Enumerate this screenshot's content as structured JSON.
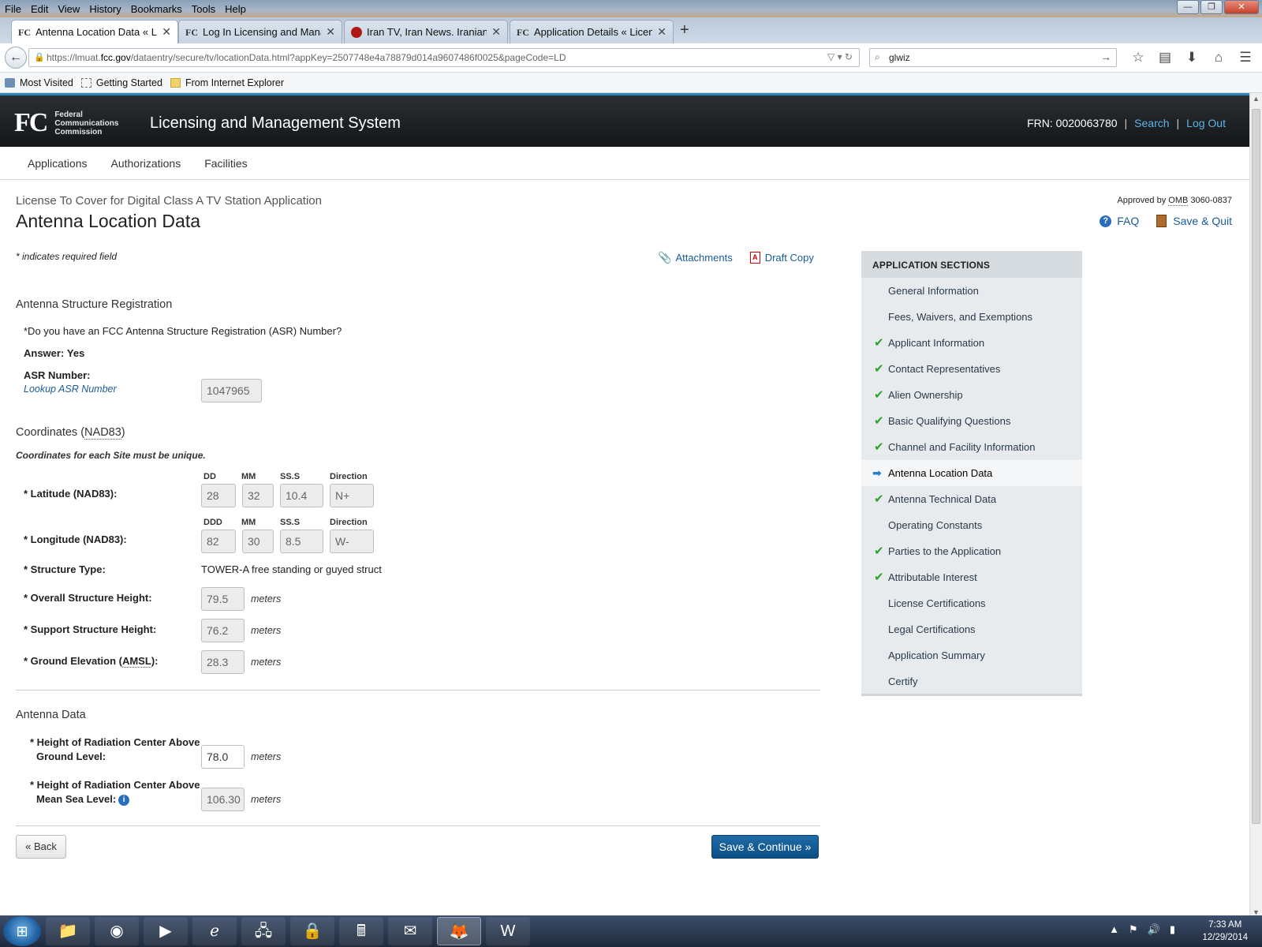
{
  "browser": {
    "menu": [
      "File",
      "Edit",
      "View",
      "History",
      "Bookmarks",
      "Tools",
      "Help"
    ],
    "tabs": [
      {
        "favicon": "FC",
        "label": "Antenna Location Data « Li...",
        "active": true
      },
      {
        "favicon": "FC",
        "label": "Log In Licensing and Mana..."
      },
      {
        "favicon": "iran-tv-favicon",
        "label": "Iran TV, Iran News. Iranian ..."
      },
      {
        "favicon": "FC",
        "label": "Application Details « Licen..."
      }
    ],
    "url_prefix": "https://lmuat.",
    "url_domain": "fcc.gov",
    "url_rest": "/dataentry/secure/tv/locationData.html?appKey=2507748e4a78879d014a9607486f0025&pageCode=LD",
    "search_value": "glwiz",
    "bookmarks": [
      "Most Visited",
      "Getting Started",
      "From Internet Explorer"
    ]
  },
  "header": {
    "logo_text": "FC",
    "agency_line1": "Federal",
    "agency_line2": "Communications",
    "agency_line3": "Commission",
    "title": "Licensing and Management System",
    "frn": "FRN: 0020063780",
    "search": "Search",
    "logout": "Log Out"
  },
  "subnav": [
    "Applications",
    "Authorizations",
    "Facilities"
  ],
  "page": {
    "subtitle": "License To Cover for Digital Class A TV Station Application",
    "title": "Antenna Location Data",
    "omb_prefix": "Approved by",
    "omb_abbr": "OMB",
    "omb_number": "3060-0837",
    "faq": "FAQ",
    "save_quit": "Save & Quit",
    "required_note": "* indicates required field",
    "attachments": "Attachments",
    "draft_copy": "Draft Copy"
  },
  "asr": {
    "section": "Antenna Structure Registration",
    "question": "*Do you have an FCC Antenna Structure Registration (ASR) Number?",
    "answer_label": "Answer:",
    "answer_value": "Yes",
    "number_label": "ASR Number:",
    "lookup_link": "Lookup ASR Number",
    "number_value": "1047965"
  },
  "coords": {
    "section_prefix": "Coordinates (",
    "section_abbr": "NAD83",
    "section_suffix": ")",
    "note": "Coordinates for each Site must be unique.",
    "lat_label": "* Latitude (NAD83):",
    "lat_headers": [
      "DD",
      "MM",
      "SS.S",
      "Direction"
    ],
    "lat_values": [
      "28",
      "32",
      "10.4",
      "N+"
    ],
    "lon_label": "* Longitude (NAD83):",
    "lon_headers": [
      "DDD",
      "MM",
      "SS.S",
      "Direction"
    ],
    "lon_values": [
      "82",
      "30",
      "8.5",
      "W-"
    ],
    "structure_type_label": "* Structure Type:",
    "structure_type_value": "TOWER-A free standing or guyed struct",
    "overall_height_label": "* Overall Structure Height:",
    "overall_height_value": "79.5",
    "support_height_label": "* Support Structure Height:",
    "support_height_value": "76.2",
    "ground_elev_prefix": "* Ground Elevation (",
    "ground_elev_abbr": "AMSL",
    "ground_elev_suffix": "):",
    "ground_elev_value": "28.3",
    "unit": "meters"
  },
  "antenna": {
    "section": "Antenna Data",
    "hrc_ground_line1": "* Height of Radiation Center Above",
    "hrc_ground_line2": "Ground Level:",
    "hrc_ground_value": "78.0",
    "hrc_msl_line1": "* Height of Radiation Center Above",
    "hrc_msl_line2": "Mean Sea Level:",
    "hrc_msl_value": "106.30",
    "unit": "meters"
  },
  "buttons": {
    "back": "« Back",
    "save_continue": "Save & Continue »"
  },
  "sidebar": {
    "heading": "APPLICATION SECTIONS",
    "items": [
      {
        "label": "General Information",
        "status": ""
      },
      {
        "label": "Fees, Waivers, and Exemptions",
        "status": ""
      },
      {
        "label": "Applicant Information",
        "status": "complete"
      },
      {
        "label": "Contact Representatives",
        "status": "complete"
      },
      {
        "label": "Alien Ownership",
        "status": "complete"
      },
      {
        "label": "Basic Qualifying Questions",
        "status": "complete"
      },
      {
        "label": "Channel and Facility Information",
        "status": "complete"
      },
      {
        "label": "Antenna Location Data",
        "status": "current"
      },
      {
        "label": "Antenna Technical Data",
        "status": "complete"
      },
      {
        "label": "Operating Constants",
        "status": ""
      },
      {
        "label": "Parties to the Application",
        "status": "complete"
      },
      {
        "label": "Attributable Interest",
        "status": "complete"
      },
      {
        "label": "License Certifications",
        "status": ""
      },
      {
        "label": "Legal Certifications",
        "status": ""
      },
      {
        "label": "Application Summary",
        "status": ""
      },
      {
        "label": "Certify",
        "status": ""
      }
    ]
  },
  "taskbar": {
    "time": "7:33 AM",
    "date": "12/29/2014"
  },
  "colors": {
    "header_bg": "#1b1e21",
    "link": "#1a5a9a",
    "primary_button": "#135a93",
    "check": "#2ea12e",
    "accent_top": "#2e84b4"
  }
}
